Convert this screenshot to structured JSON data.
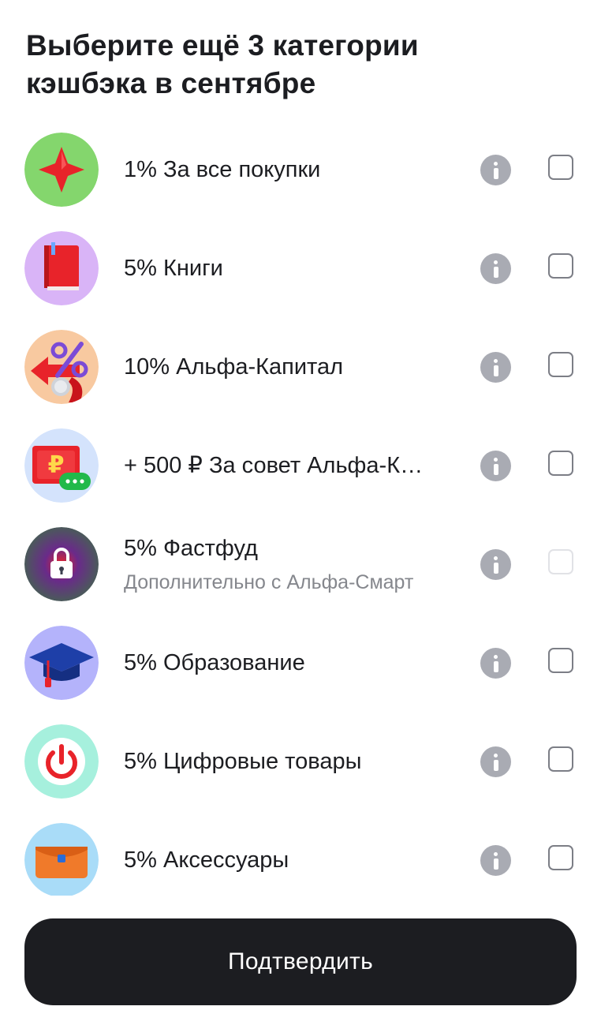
{
  "header": {
    "title_line1": "Выберите ещё 3 категории",
    "title_line2": "кэшбэка в сентябре"
  },
  "categories": [
    {
      "label": "1% За все покупки",
      "sublabel": "",
      "icon": "red-star-icon",
      "bg": "#84d66d",
      "checked": false,
      "disabled": false
    },
    {
      "label": "5% Книги",
      "sublabel": "",
      "icon": "red-book-icon",
      "bg": "#d9b4f7",
      "checked": false,
      "disabled": false
    },
    {
      "label": "10% Альфа-Капитал",
      "sublabel": "",
      "icon": "percent-arrow-icon",
      "bg": "#f8c9a0",
      "checked": false,
      "disabled": false
    },
    {
      "label": "+ 500 ₽ За совет Альфа-К…",
      "sublabel": "",
      "icon": "ruble-card-chat-icon",
      "bg": "#d4e3fc",
      "checked": false,
      "disabled": false
    },
    {
      "label": "5% Фастфуд",
      "sublabel": "Дополнительно с Альфа-Смарт",
      "icon": "lock-icon",
      "bg": "#3b3f4e",
      "checked": false,
      "disabled": true
    },
    {
      "label": "5% Образование",
      "sublabel": "",
      "icon": "graduation-cap-icon",
      "bg": "#b4b3fb",
      "checked": false,
      "disabled": false
    },
    {
      "label": "5% Цифровые товары",
      "sublabel": "",
      "icon": "power-button-icon",
      "bg": "#a6f0dd",
      "checked": false,
      "disabled": false
    },
    {
      "label": "5% Аксессуары",
      "sublabel": "",
      "icon": "orange-wallet-icon",
      "bg": "#a9dcf8",
      "checked": false,
      "disabled": false
    }
  ],
  "footer": {
    "confirm_label": "Подтвердить"
  }
}
